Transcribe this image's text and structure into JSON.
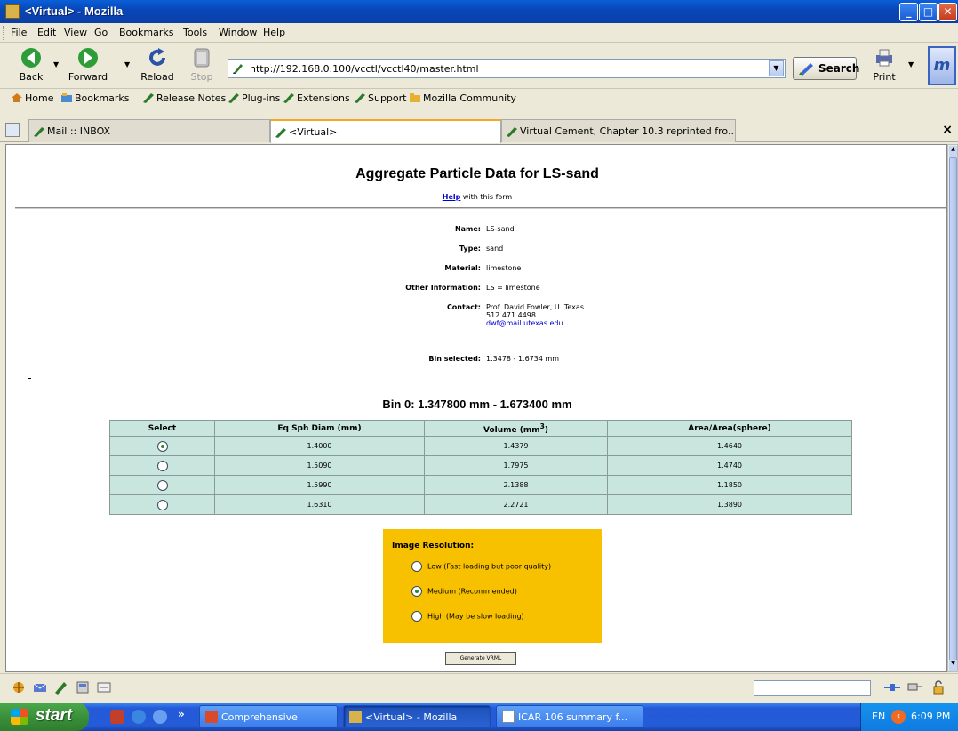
{
  "window": {
    "title": "<Virtual> - Mozilla",
    "controls": {
      "minimize": "_",
      "maximize": "□",
      "close": "✕"
    }
  },
  "menubar": {
    "items": [
      "File",
      "Edit",
      "View",
      "Go",
      "Bookmarks",
      "Tools",
      "Window",
      "Help"
    ]
  },
  "navbar": {
    "back": "Back",
    "forward": "Forward",
    "reload": "Reload",
    "stop": "Stop",
    "url": "http://192.168.0.100/vcctl/vcctl40/master.html",
    "search": "Search",
    "print": "Print",
    "brand_glyph": "m"
  },
  "bookmarks_bar": {
    "items": [
      "Home",
      "Bookmarks",
      "Release Notes",
      "Plug-ins",
      "Extensions",
      "Support",
      "Mozilla Community"
    ]
  },
  "tabs": {
    "items": [
      {
        "label": "Mail :: INBOX",
        "active": false
      },
      {
        "label": "<Virtual>",
        "active": true
      },
      {
        "label": "Virtual Cement, Chapter 10.3 reprinted fro...",
        "active": false
      }
    ],
    "close_glyph": "×"
  },
  "page": {
    "title": "Aggregate Particle Data for LS-sand",
    "help_link": "Help",
    "help_suffix": "with this form",
    "info": {
      "name_label": "Name:",
      "name_value": "LS-sand",
      "type_label": "Type:",
      "type_value": "sand",
      "material_label": "Material:",
      "material_value": "limestone",
      "other_label": "Other Information:",
      "other_value": "LS = limestone",
      "contact_label": "Contact:",
      "contact_name": "Prof. David Fowler, U. Texas",
      "contact_phone": "512.471.4498",
      "contact_email": "dwf@mail.utexas.edu",
      "bin_label": "Bin selected:",
      "bin_value": "1.3478 - 1.6734 mm"
    },
    "bin_title": "Bin 0: 1.347800 mm - 1.673400 mm",
    "table": {
      "headers": [
        "Select",
        "Eq Sph Diam (mm)",
        "Volume (mm",
        "Area/Area(sphere)"
      ],
      "volume_sup": "3",
      "volume_close": ")",
      "rows": [
        {
          "selected": true,
          "diam": "1.4000",
          "volume": "1.4379",
          "area": "1.4640"
        },
        {
          "selected": false,
          "diam": "1.5090",
          "volume": "1.7975",
          "area": "1.4740"
        },
        {
          "selected": false,
          "diam": "1.5990",
          "volume": "2.1388",
          "area": "1.1850"
        },
        {
          "selected": false,
          "diam": "1.6310",
          "volume": "2.2721",
          "area": "1.3890"
        }
      ]
    },
    "resolution": {
      "title": "Image Resolution:",
      "options": [
        {
          "label": "Low (Fast loading but poor quality)",
          "selected": false
        },
        {
          "label": "Medium (Recommended)",
          "selected": true
        },
        {
          "label": "High (May be slow loading)",
          "selected": false
        }
      ]
    },
    "generate_button": "Generate VRML"
  },
  "taskbar": {
    "start": "start",
    "more": "»",
    "tasks": [
      {
        "label": "Comprehensive",
        "active": false
      },
      {
        "label": "<Virtual> - Mozilla",
        "active": true
      },
      {
        "label": "ICAR 106 summary f...",
        "active": false
      }
    ],
    "lang": "EN",
    "clock": "6:09 PM"
  },
  "colors": {
    "table_cell": "#c9e6de",
    "resolution_box": "#f8c100",
    "tab_accent": "#f5a623"
  }
}
